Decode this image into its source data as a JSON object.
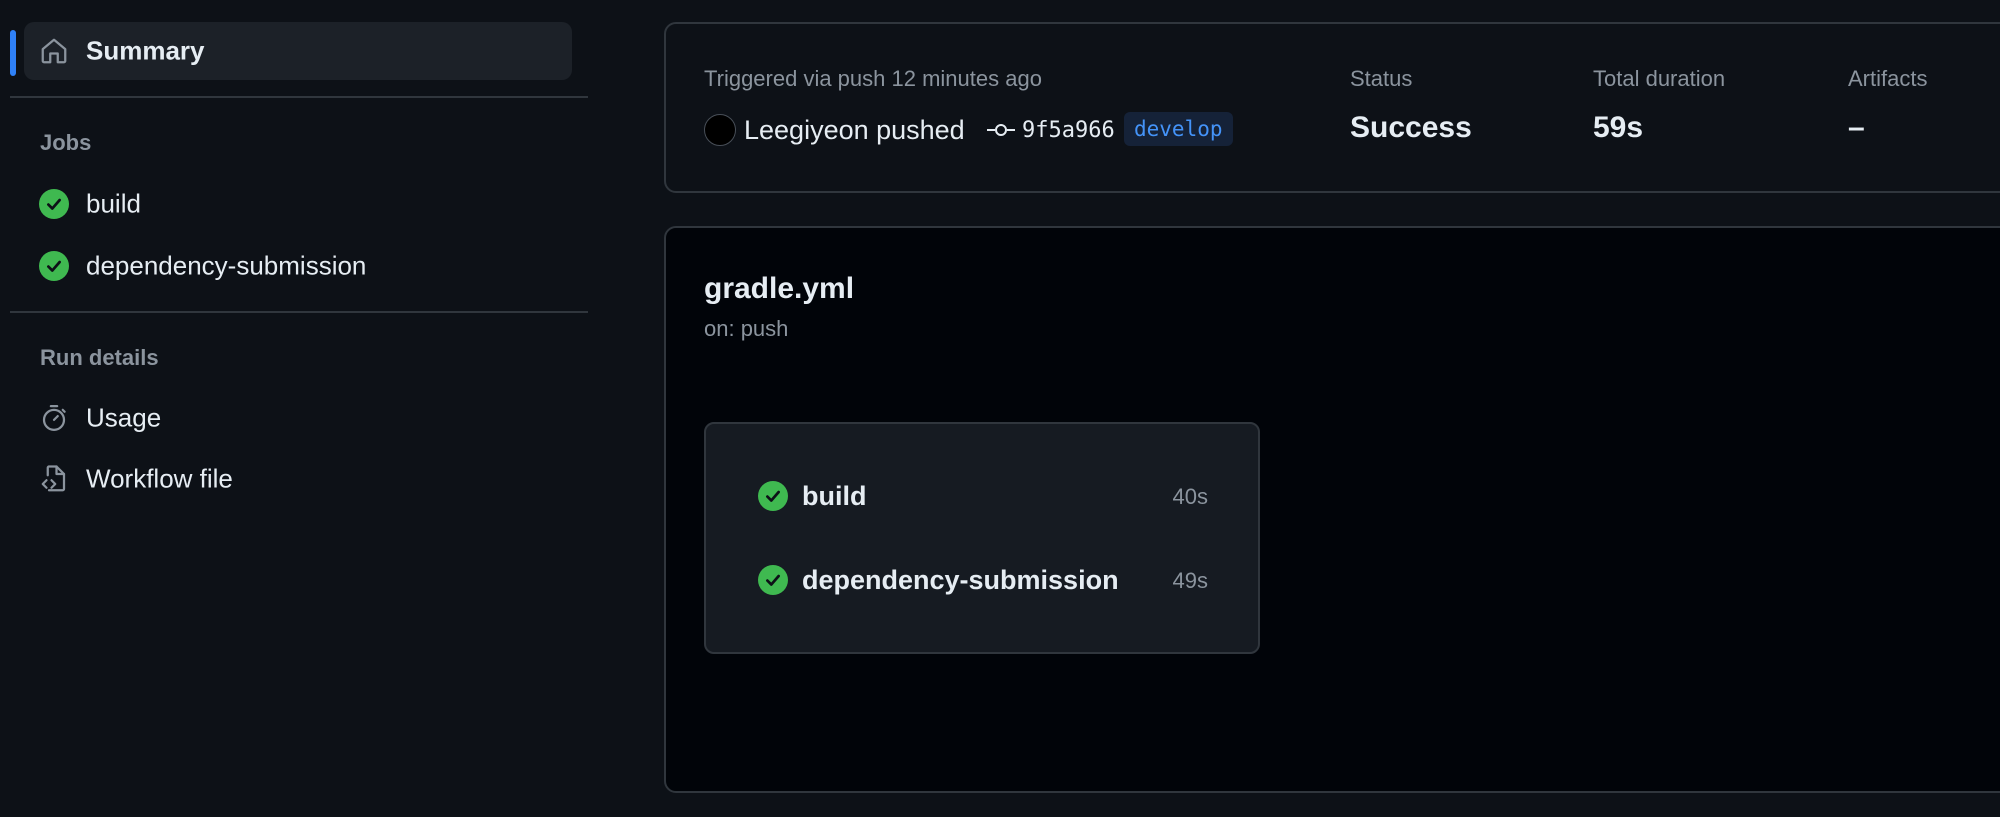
{
  "sidebar": {
    "summary_label": "Summary",
    "jobs_title": "Jobs",
    "jobs": [
      {
        "label": "build",
        "status": "success"
      },
      {
        "label": "dependency-submission",
        "status": "success"
      }
    ],
    "run_details_title": "Run details",
    "run_details": [
      {
        "label": "Usage",
        "icon": "stopwatch-icon"
      },
      {
        "label": "Workflow file",
        "icon": "file-code-icon"
      }
    ]
  },
  "summary": {
    "triggered_text": "Triggered via push 12 minutes ago",
    "pusher_text": "Leegiyeon pushed",
    "commit_sha": "9f5a966",
    "branch": "develop",
    "status_label": "Status",
    "status_value": "Success",
    "duration_label": "Total duration",
    "duration_value": "59s",
    "artifacts_label": "Artifacts",
    "artifacts_value": "–"
  },
  "workflow": {
    "name": "gradle.yml",
    "trigger": "on: push",
    "jobs": [
      {
        "name": "build",
        "duration": "40s"
      },
      {
        "name": "dependency-submission",
        "duration": "49s"
      }
    ]
  },
  "colors": {
    "accent": "#2f81f7",
    "success": "#3fb950",
    "background": "#0d1117",
    "branch_text": "#4493f8"
  }
}
